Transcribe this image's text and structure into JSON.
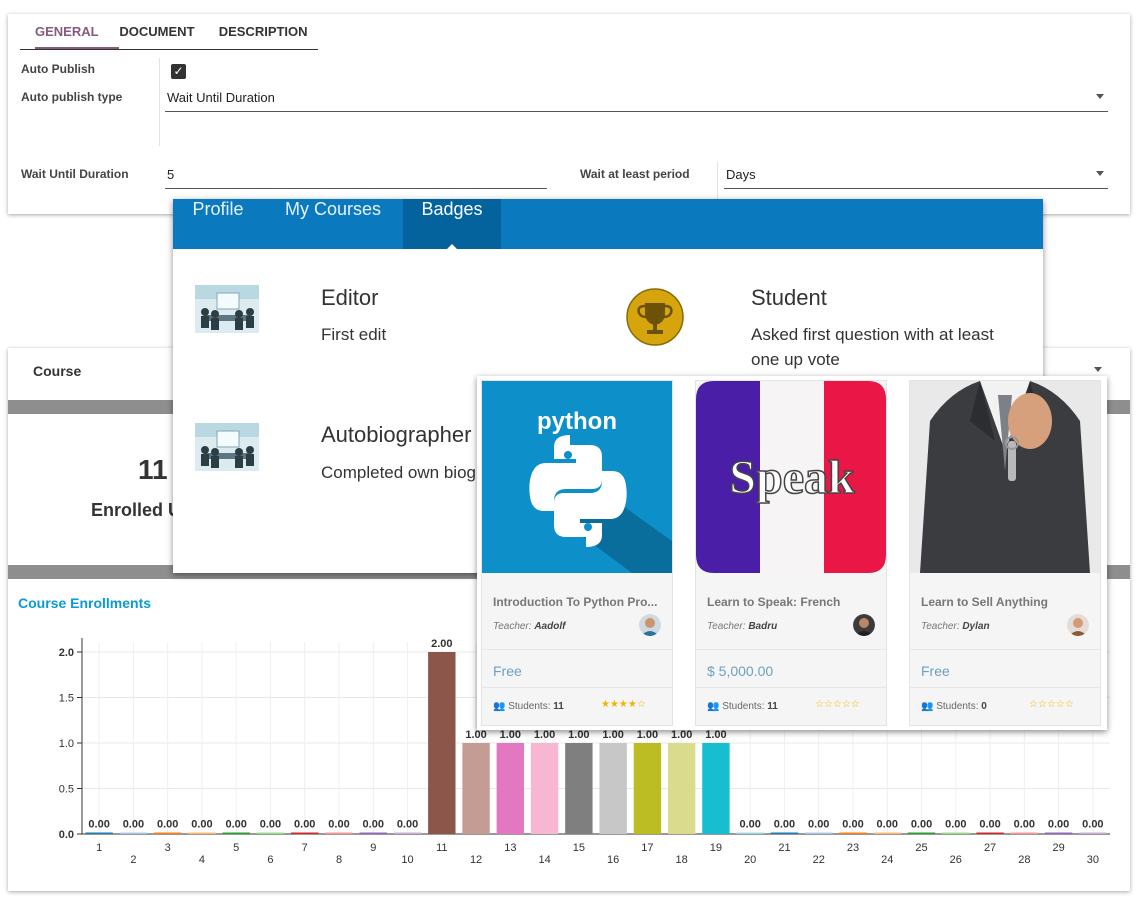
{
  "settings": {
    "tabs": [
      "GENERAL",
      "DOCUMENT",
      "DESCRIPTION"
    ],
    "auto_publish_label": "Auto Publish",
    "auto_publish_checked": true,
    "auto_publish_type_label": "Auto publish type",
    "auto_publish_type_value": "Wait Until Duration",
    "wait_until_duration_label": "Wait Until Duration",
    "wait_until_duration_value": "5",
    "wait_period_label": "Wait at least period",
    "wait_period_value": "Days"
  },
  "badges": {
    "tabs": [
      "Profile",
      "My Courses",
      "Badges"
    ],
    "active_tab": "Badges",
    "items": [
      {
        "title": "Editor",
        "desc": "First edit",
        "icon": "meeting-icon"
      },
      {
        "title": "Student",
        "desc": "Asked first question with at least",
        "desc2": "one up vote",
        "icon": "trophy-icon"
      },
      {
        "title": "Autobiographer",
        "desc": "Completed own biog",
        "icon": "meeting-icon"
      }
    ]
  },
  "dashboard": {
    "course_label": "Course",
    "enrolled_count": "11",
    "enrolled_label": "Enrolled U",
    "chart_title": "Course Enrollments"
  },
  "courses": [
    {
      "title": "Introduction To Python Pro...",
      "teacher_prefix": "Teacher:",
      "teacher": "Aadolf",
      "price": "Free",
      "students_prefix": "Students:",
      "students": "11",
      "rating": 4,
      "image_text": "python",
      "image": "python-logo"
    },
    {
      "title": "Learn to Speak: French",
      "teacher_prefix": "Teacher:",
      "teacher": "Badru",
      "price": "$ 5,000.00",
      "students_prefix": "Students:",
      "students": "11",
      "rating": 0,
      "image_text": "Speak",
      "image": "french-flag"
    },
    {
      "title": "Learn to Sell Anything",
      "teacher_prefix": "Teacher:",
      "teacher": "Dylan",
      "price": "Free",
      "students_prefix": "Students:",
      "students": "0",
      "rating": 0,
      "image_text": "",
      "image": "businessman-key"
    }
  ],
  "colors": {
    "odoo_purple": "#875A7B",
    "nav_blue": "#0a79bd",
    "chart_title": "#0a9bd6",
    "price": "#6d9fc0",
    "star": "#f0b400"
  },
  "chart_data": {
    "type": "bar",
    "title": "Course Enrollments",
    "categories": [
      "1",
      "2",
      "3",
      "4",
      "5",
      "6",
      "7",
      "8",
      "9",
      "10",
      "11",
      "12",
      "13",
      "14",
      "15",
      "16",
      "17",
      "18",
      "19",
      "20",
      "21",
      "22",
      "23",
      "24",
      "25",
      "26",
      "27",
      "28",
      "29",
      "30"
    ],
    "values": [
      0,
      0,
      0,
      0,
      0,
      0,
      0,
      0,
      0,
      0,
      2,
      1,
      1,
      1,
      1,
      1,
      1,
      1,
      1,
      0,
      0,
      0,
      0,
      0,
      0,
      0,
      0,
      0,
      0,
      0
    ],
    "value_labels": [
      "0.00",
      "0.00",
      "0.00",
      "0.00",
      "0.00",
      "0.00",
      "0.00",
      "0.00",
      "0.00",
      "0.00",
      "2.00",
      "1.00",
      "1.00",
      "1.00",
      "1.00",
      "1.00",
      "1.00",
      "1.00",
      "1.00",
      "0.00",
      "0.00",
      "0.00",
      "0.00",
      "0.00",
      "0.00",
      "0.00",
      "0.00",
      "0.00",
      "0.00",
      "0.00"
    ],
    "colors": [
      "#1f77b4",
      "#aec7e8",
      "#ff7f0e",
      "#ffbb78",
      "#2ca02c",
      "#98df8a",
      "#d62728",
      "#ff9896",
      "#9467bd",
      "#c5b0d5",
      "#8c564b",
      "#c49c94",
      "#e377c2",
      "#f7b6d2",
      "#7f7f7f",
      "#c7c7c7",
      "#bcbd22",
      "#dbdb8d",
      "#17becf",
      "#9edae5",
      "#1f77b4",
      "#aec7e8",
      "#ff7f0e",
      "#ffbb78",
      "#2ca02c",
      "#98df8a",
      "#d62728",
      "#ff9896",
      "#9467bd",
      "#c5b0d5"
    ],
    "yticks": [
      "0.0",
      "0.5",
      "1.0",
      "1.5",
      "2.0"
    ],
    "ylim": [
      0,
      2
    ],
    "grid": true
  }
}
